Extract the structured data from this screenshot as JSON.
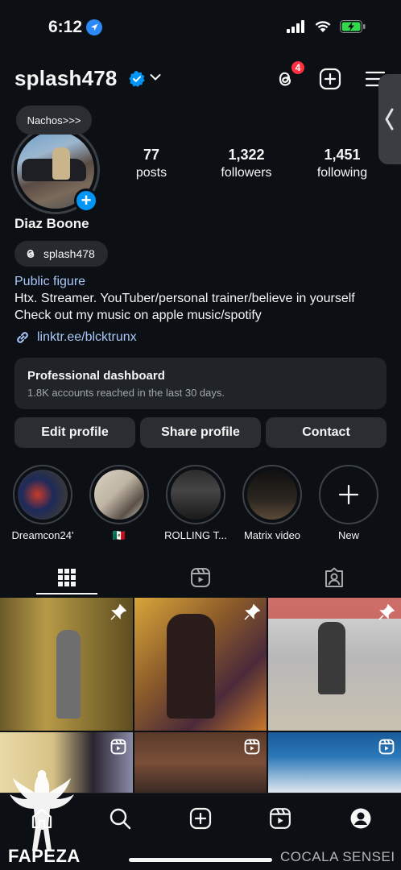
{
  "status_bar": {
    "time": "6:12"
  },
  "header": {
    "username": "splash478",
    "threads_badge": "4"
  },
  "profile": {
    "note": "Nachos>>>",
    "display_name": "Diaz Boone",
    "threads_handle": "splash478",
    "category": "Public figure",
    "bio_line1": "Htx. Streamer. YouTuber/personal trainer/believe in yourself",
    "bio_line2": "Check out my music on apple music/spotify",
    "link": "linktr.ee/blcktrunx"
  },
  "stats": [
    {
      "value": "77",
      "label": "posts"
    },
    {
      "value": "1,322",
      "label": "followers"
    },
    {
      "value": "1,451",
      "label": "following"
    }
  ],
  "dashboard": {
    "title": "Professional dashboard",
    "subtitle": "1.8K accounts reached in the last 30 days."
  },
  "buttons": {
    "edit": "Edit profile",
    "share": "Share profile",
    "contact": "Contact"
  },
  "highlights": [
    {
      "label": "Dreamcon24'"
    },
    {
      "label": "🇲🇽"
    },
    {
      "label": "ROLLING T..."
    },
    {
      "label": "Matrix video"
    },
    {
      "label": "New"
    }
  ],
  "watermark": {
    "left": "FAPEZA",
    "right": "COCALA SENSEI"
  },
  "colors": {
    "background": "#0c1014",
    "accent": "#0095f6",
    "link": "#a8c7fa",
    "badge": "#ff3040"
  }
}
